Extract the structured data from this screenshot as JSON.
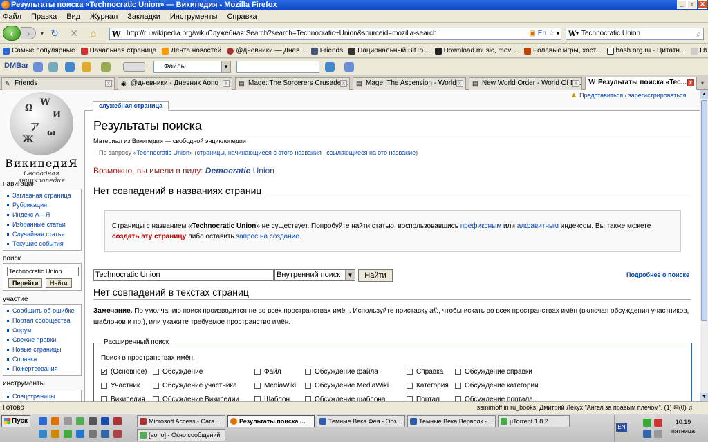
{
  "window": {
    "title": "Результаты поиска «Technocratic Union» — Википедия - Mozilla Firefox"
  },
  "menu": [
    "Файл",
    "Правка",
    "Вид",
    "Журнал",
    "Закладки",
    "Инструменты",
    "Справка"
  ],
  "nav": {
    "url": "http://ru.wikipedia.org/wiki/Служебная:Search?search=Technocratic+Union&sourceid=mozilla-search",
    "lang_badge": "En",
    "search_value": "Technocratic Union"
  },
  "bookmarks": [
    "Самые популярные",
    "Начальная страница",
    "Лента новостей",
    "@дневники — Днев...",
    "Friends",
    "Национальный BitTo...",
    "Download music, movi...",
    "Ролевые игры, хост...",
    "bash.org.ru - Цитатн...",
    "НЯШ"
  ],
  "dmbar": {
    "label": "DMBar",
    "files": "Файлы"
  },
  "tabs": [
    "Friends",
    "@дневники - Дневник Аопо",
    "Mage: The Sorcerers Crusade ...",
    "Mage: The Ascension - World ...",
    "New World Order - World Of D...",
    "Результаты поиска «Tec..."
  ],
  "wiki": {
    "user_links": "Представиться / зарегистрироваться",
    "special_tab": "служебная страница",
    "logo_title": "ВикипедиЯ",
    "logo_sub": "Свободная энциклопедия",
    "sections": {
      "nav_h": "навигация",
      "nav": [
        "Заглавная страница",
        "Рубрикация",
        "Индекс А—Я",
        "Избранные статьи",
        "Случайная статья",
        "Текущие события"
      ],
      "search_h": "поиск",
      "search_value": "Technocratic Union",
      "go": "Перейти",
      "find": "Найти",
      "part_h": "участие",
      "part": [
        "Сообщить об ошибке",
        "Портал сообщества",
        "Форум",
        "Свежие правки",
        "Новые страницы",
        "Справка",
        "Пожертвования"
      ],
      "tools_h": "инструменты",
      "tools": [
        "Спецстраницы"
      ]
    },
    "title": "Результаты поиска",
    "subtitle": "Материал из Википедии — свободной энциклопедии",
    "req_prefix": "По запросу «",
    "req_term": "Technocratic Union",
    "req_suffix": "» (",
    "req_link1": "страницы, начинающиеся с этого названия",
    "req_sep": " | ",
    "req_link2": "ссылающиеся на это название",
    "req_end": ")",
    "suggest_prefix": "Возможно, вы имели в виду: ",
    "suggest_word": "Democratic",
    "suggest_rest": " Union",
    "h_titles": "Нет совпадений в названиях страниц",
    "note_a": "Страницы с названием «",
    "note_term": "Technocratic Union",
    "note_b": "» не существует. Попробуйте найти статью, воспользовавшись ",
    "note_l1": "префиксным",
    "note_c": " или ",
    "note_l2": "алфавитным",
    "note_d": " индексом. Вы также можете ",
    "note_l3": "создать эту страницу",
    "note_e": " либо оставить ",
    "note_l4": "запрос на создание",
    "note_f": ".",
    "query_value": "Technocratic Union",
    "ns_select": "Внутренний поиск",
    "find_btn": "Найти",
    "more_help": "Подробнее о поиске",
    "h_text": "Нет совпадений в текстах страниц",
    "remark_b": "Замечание.",
    "remark": " По умолчанию поиск производится не во всех пространствах имён. Используйте приставку ",
    "remark_all": "all:",
    "remark2": ", чтобы искать во всех пространствах имён (включая обсуждения участников, шаблонов и пр.), или укажите требуемое пространство имён.",
    "adv_legend": "Расширенный поиск",
    "adv_label": "Поиск в пространствах имён:",
    "ns": [
      [
        "(Основное)",
        "Обсуждение",
        "Файл",
        "Обсуждение файла",
        "Справка",
        "Обсуждение справки"
      ],
      [
        "Участник",
        "Обсуждение участника",
        "MediaWiki",
        "Обсуждение MediaWiki",
        "Категория",
        "Обсуждение категории"
      ],
      [
        "Википедия",
        "Обсуждение Википедии",
        "Шаблон",
        "Обсуждение шаблона",
        "Портал",
        "Обсуждение портала"
      ]
    ]
  },
  "status": {
    "left": "Готово",
    "right": "ssmirnoff in ru_books: Дмитрий Лекух \"Ангел за правым плечом\". (1)",
    "counts": "(0)"
  },
  "taskbar": {
    "start": "Пуск",
    "tasks": [
      "Microsoft Access - Сага ...",
      "Результаты поиска ...",
      "Темные Века Фея - Обз...",
      "Темные Века Верволк - ...",
      "µTorrent 1.8.2",
      "[aono] - Окно сообщений"
    ],
    "lang": "EN",
    "time": "10:19",
    "day": "пятница"
  }
}
